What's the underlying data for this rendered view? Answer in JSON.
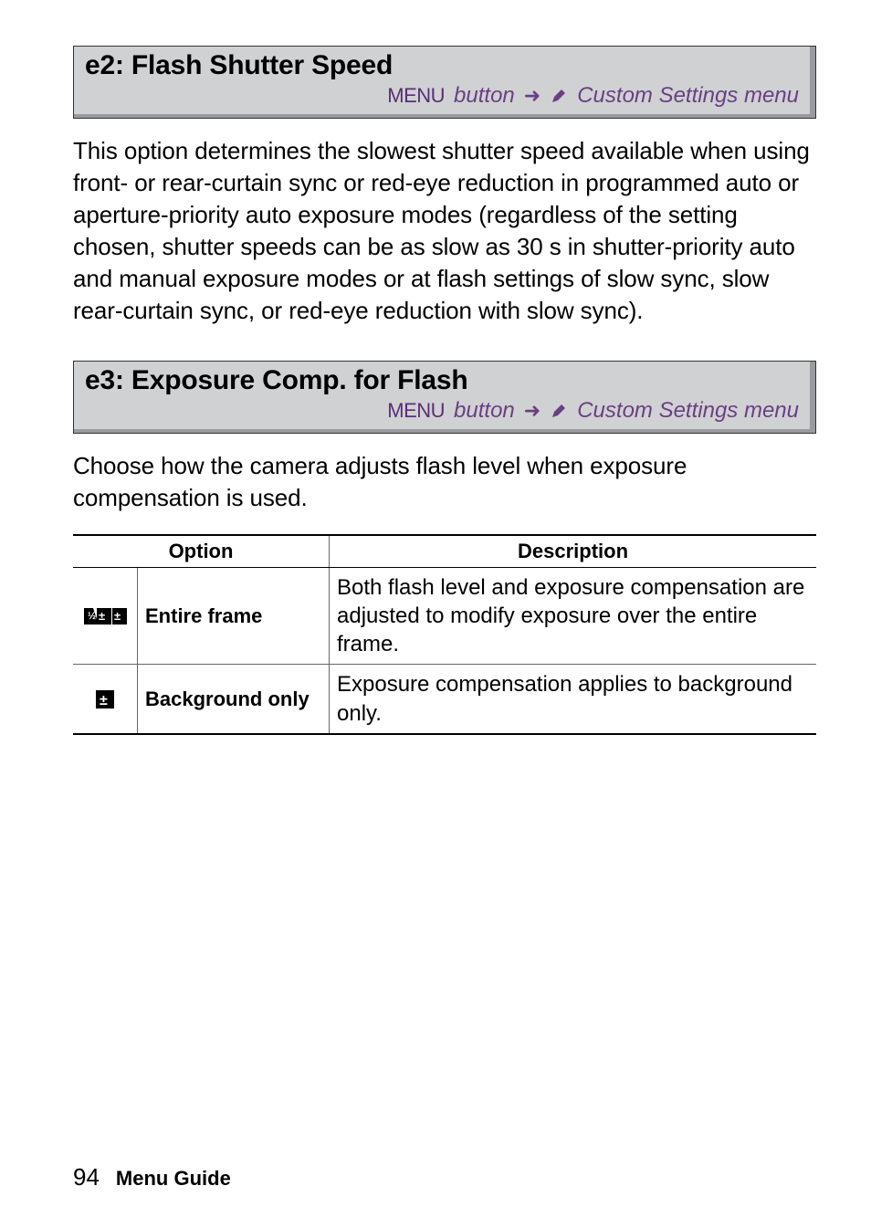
{
  "sections": [
    {
      "title": "e2: Flash Shutter Speed",
      "crumb_menu": "MENU",
      "crumb_button": "button",
      "crumb_target": "Custom Settings menu",
      "body": "This option determines the slowest shutter speed available when using front- or rear-curtain sync or red-eye reduction in programmed auto or aperture-priority auto exposure modes (regardless of the setting chosen, shutter speeds can be as slow as 30 s in shutter-priority auto and manual exposure modes or at flash settings of slow sync, slow rear-curtain sync, or red-eye reduction with slow sync)."
    },
    {
      "title": "e3: Exposure Comp. for Flash",
      "crumb_menu": "MENU",
      "crumb_button": "button",
      "crumb_target": "Custom Settings menu",
      "body": "Choose how the camera adjusts flash level when exposure compensation is used."
    }
  ],
  "table": {
    "headers": {
      "option": "Option",
      "description": "Description"
    },
    "rows": [
      {
        "icon": "entire-frame-icon",
        "label": "Entire frame",
        "desc": "Both flash level and exposure compensation are adjusted to modify exposure over the entire frame."
      },
      {
        "icon": "background-only-icon",
        "label": "Background only",
        "desc": "Exposure compensation applies to background only."
      }
    ]
  },
  "footer": {
    "page": "94",
    "label": "Menu Guide"
  }
}
